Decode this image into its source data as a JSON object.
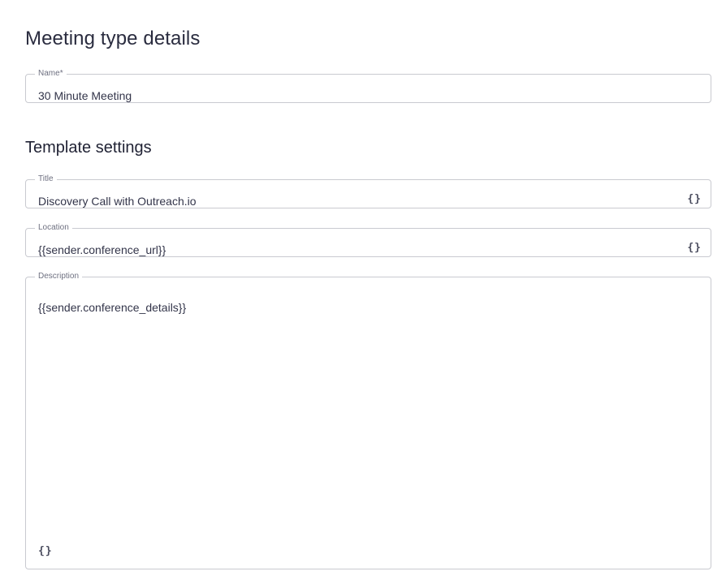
{
  "meeting_type_details": {
    "heading": "Meeting type details",
    "name_field": {
      "label": "Name",
      "required_marker": "*",
      "value": "30 Minute Meeting"
    }
  },
  "template_settings": {
    "heading": "Template settings",
    "title_field": {
      "label": "Title",
      "value": "Discovery Call with Outreach.io",
      "variable_button": "{}"
    },
    "location_field": {
      "label": "Location",
      "value": "{{sender.conference_url}}",
      "variable_button": "{}"
    },
    "description_field": {
      "label": "Description",
      "value": "{{sender.conference_details}}",
      "variable_button": "{}"
    }
  },
  "icons": {
    "variable_insert": "curly-braces-icon"
  },
  "colors": {
    "text_primary": "#2a2c3f",
    "border": "#c9cad0",
    "label": "#6e7080"
  }
}
